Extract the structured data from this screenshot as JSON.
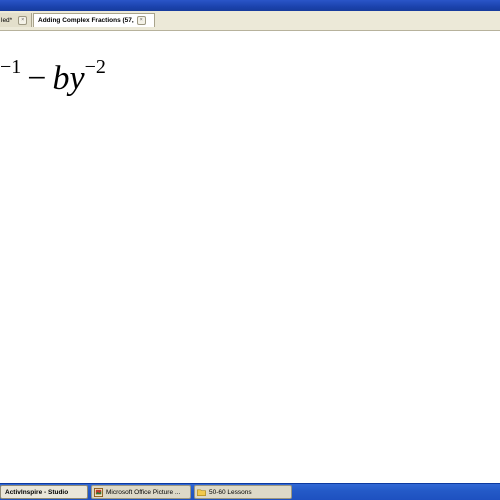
{
  "tabs": [
    {
      "label": "led*",
      "close": "×"
    },
    {
      "label": "Adding Complex Fractions (57,",
      "close": "×"
    }
  ],
  "math": {
    "exp1": "−1",
    "minus": "−",
    "coef": "b",
    "var": "y",
    "exp2": "−2"
  },
  "taskbar": {
    "items": [
      {
        "label": "ActivInspire - Studio",
        "icon": "activinspire-icon"
      },
      {
        "label": "Microsoft Office Picture ...",
        "icon": "picture-manager-icon"
      },
      {
        "label": "50-60 Lessons",
        "icon": "folder-icon"
      }
    ]
  }
}
